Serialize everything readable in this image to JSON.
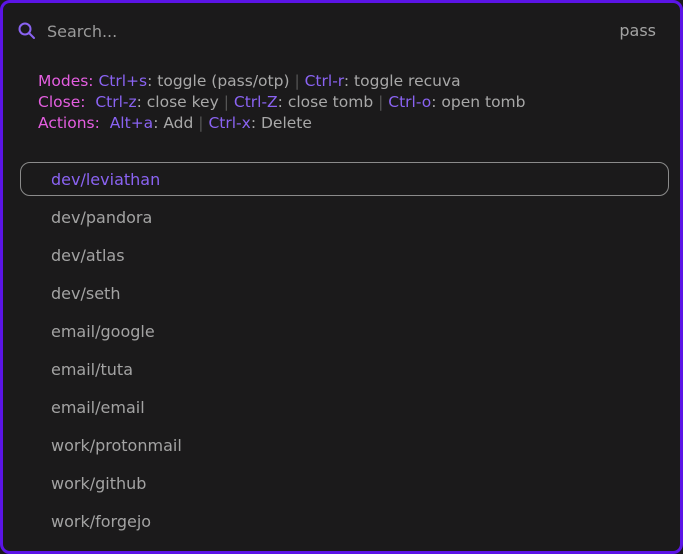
{
  "colors": {
    "border": "#5b14e6",
    "background": "#1b1a1b",
    "pink": "#e45ee0",
    "violet": "#8a63f2",
    "text": "#a3a3a3"
  },
  "search": {
    "placeholder": "Search...",
    "value": "",
    "mode_label": "pass",
    "icon": "search-icon"
  },
  "help": {
    "modes": {
      "title": "Modes:",
      "k1": "Ctrl+s",
      "t1": ": toggle (pass/otp)",
      "sep": "|",
      "k2": "Ctrl-r",
      "t2": ": toggle recuva"
    },
    "close": {
      "title": "Close:",
      "k1": "Ctrl-z",
      "t1": ": close key",
      "sep1": "|",
      "k2": "Ctrl-Z",
      "t2": ": close tomb",
      "sep2": "|",
      "k3": "Ctrl-o",
      "t3": ": open tomb"
    },
    "actions": {
      "title": "Actions:",
      "k1": "Alt+a",
      "t1": ": Add",
      "sep": "|",
      "k2": "Ctrl-x",
      "t2": ": Delete"
    }
  },
  "entries": [
    "dev/leviathan",
    "dev/pandora",
    "dev/atlas",
    "dev/seth",
    "email/google",
    "email/tuta",
    "email/email",
    "work/protonmail",
    "work/github",
    "work/forgejo"
  ],
  "selected_index": 0
}
